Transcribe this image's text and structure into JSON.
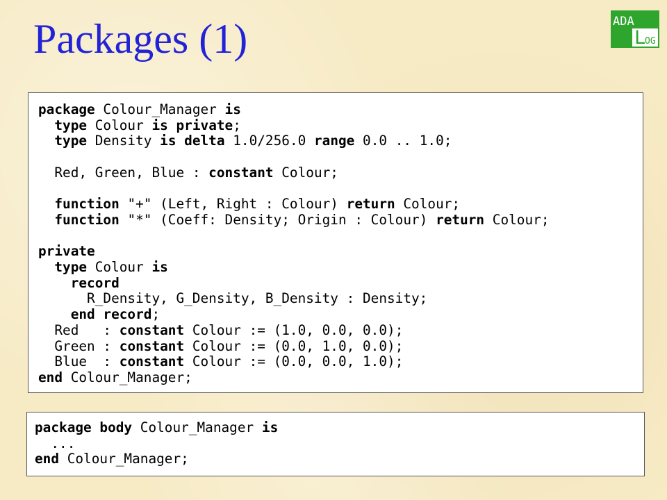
{
  "slide": {
    "title": "Packages (1)",
    "logo": {
      "line1": "ADA",
      "line2_initial": "L",
      "line2_rest": "OG",
      "color": "#2ea62e"
    }
  },
  "colors": {
    "title": "#2323d6",
    "background": "#f7ebc6",
    "panel": "#ffffff"
  },
  "spec_code": {
    "l1": {
      "k1": "package",
      "t1": " Colour_Manager ",
      "k2": "is"
    },
    "l2": {
      "indent": "  ",
      "k1": "type",
      "t1": " Colour ",
      "k2": "is private",
      "t2": ";"
    },
    "l3": {
      "indent": "  ",
      "k1": "type",
      "t1": " Density ",
      "k2": "is delta",
      "t2": " 1.0/256.0 ",
      "k3": "range",
      "t3": " 0.0 .. 1.0;"
    },
    "l5": {
      "indent": "  ",
      "t1": "Red, Green, Blue : ",
      "k1": "constant",
      "t2": " Colour;"
    },
    "l7": {
      "indent": "  ",
      "k1": "function",
      "t1": " \"+\" (Left, Right : Colour) ",
      "k2": "return",
      "t2": " Colour;"
    },
    "l8": {
      "indent": "  ",
      "k1": "function",
      "t1": " \"*\" (Coeff: Density; Origin : Colour) ",
      "k2": "return",
      "t2": " Colour;"
    },
    "l10": {
      "k1": "private"
    },
    "l11": {
      "indent": "  ",
      "k1": "type",
      "t1": " Colour ",
      "k2": "is"
    },
    "l12": {
      "indent": "    ",
      "k1": "record"
    },
    "l13": {
      "indent": "      ",
      "t1": "R_Density, G_Density, B_Density : Density;"
    },
    "l14": {
      "indent": "    ",
      "k1": "end record",
      "t1": ";"
    },
    "l15": {
      "indent": "  ",
      "t1": "Red   : ",
      "k1": "constant",
      "t2": " Colour := (1.0, 0.0, 0.0);"
    },
    "l16": {
      "indent": "  ",
      "t1": "Green : ",
      "k1": "constant",
      "t2": " Colour := (0.0, 1.0, 0.0);"
    },
    "l17": {
      "indent": "  ",
      "t1": "Blue  : ",
      "k1": "constant",
      "t2": " Colour := (0.0, 0.0, 1.0);"
    },
    "l18": {
      "k1": "end",
      "t1": " Colour_Manager;"
    }
  },
  "body_code": {
    "l1": {
      "k1": "package body",
      "t1": " Colour_Manager ",
      "k2": "is"
    },
    "l2": {
      "indent": "  ",
      "t1": "..."
    },
    "l3": {
      "k1": "end",
      "t1": " Colour_Manager;"
    }
  }
}
